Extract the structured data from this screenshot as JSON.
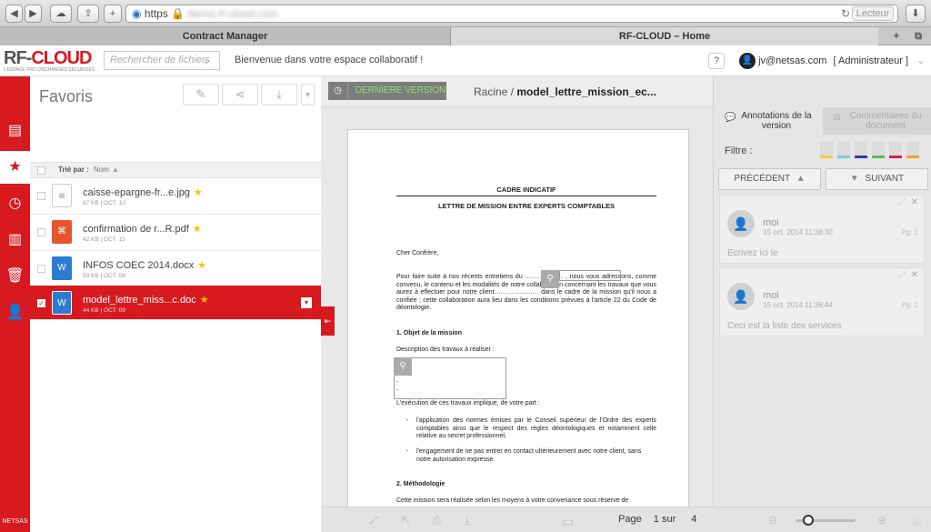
{
  "browser": {
    "back_icon": "left-arrow",
    "forward_icon": "right-arrow",
    "url_prefix": "https",
    "url_rest": "demo.rf-cloud.com",
    "reader_label": "Lecteur",
    "tabs": [
      {
        "label": "Contract Manager"
      },
      {
        "label": "RF-CLOUD – Home"
      }
    ]
  },
  "header": {
    "logo_main": "RF-",
    "logo_accent": "CLOUD",
    "logo_tagline": "L'ESPACE PRO D'ÉCHANGES SÉCURISÉS",
    "search_placeholder": "Rechercher de fichiers",
    "welcome": "Bienvenue dans votre espace collaboratif !",
    "help_label": "?",
    "user_email": "jv@netsas.com",
    "user_role": "[ Administrateur ]"
  },
  "rail": {
    "brand": "NETSAS"
  },
  "favorites": {
    "title": "Favoris",
    "sort_label": "Trié par :",
    "sort_field": "Nom",
    "files": [
      {
        "name": "caisse-epargne-fr...e.jpg",
        "meta": "67 KB  |  OCT. 10",
        "type": "image",
        "selected": false
      },
      {
        "name": "confirmation de r...R.pdf",
        "meta": "42 KB  |  OCT. 15",
        "type": "pdf",
        "selected": false
      },
      {
        "name": "INFOS COEC 2014.docx",
        "meta": "90 KB  |  OCT. 08",
        "type": "word",
        "selected": false
      },
      {
        "name": "model_lettre_miss...c.doc",
        "meta": "44 KB  |  OCT. 09",
        "type": "word",
        "selected": true
      }
    ]
  },
  "viewer": {
    "version_label": "DERNIERE VERSION",
    "breadcrumb_root": "Racine",
    "breadcrumb_sep": "/",
    "breadcrumb_file": "model_lettre_mission_ec...",
    "page_label": "Page",
    "page_current": "1",
    "page_of": "sur",
    "page_total": "4",
    "document": {
      "heading1": "CADRE INDICATIF",
      "heading2": "LETTRE DE MISSION ENTRE EXPERTS COMPTABLES",
      "salutation": "Cher Confrère,",
      "para1": "Pour faire suite à nos récents entretiens du ……………… , nous vous adressons, comme convenu, le contenu et les modalités de notre collaboration concernant les travaux que vous aurez à effectuer pour notre client………………… dans le cadre de la mission qu'il nous a confiée ; cette collaboration aura lieu dans les conditions prévues à l'article 22 du Code de déontologie.",
      "section1": "1.   Objet de la mission",
      "desc": "Description des travaux à réaliser :",
      "dash1": "-",
      "dash2": "-",
      "exec": "L'exécution de ces travaux implique, de votre part :",
      "bullet1": "l'application des normes émises par le Conseil supérieur de l'Ordre des experts comptables ainsi que le respect des règles déontologiques et notamment celle relative au secret professionnel,",
      "bullet2": "l'engagement de ne pas entrer en contact ultérieurement avec notre client, sans notre autorisation expresse.",
      "section2": "2.   Méthodologie",
      "method": "Cette mission sera réalisée selon les moyens à votre convenance sous réserve de"
    }
  },
  "annotations": {
    "tab_active": "Annotations de la version",
    "tab_inactive": "Commentaires du document",
    "filter_label": "Filtre :",
    "filter_colors": [
      "#f4d03f",
      "#7ec8e3",
      "#2c3e99",
      "#5cb85c",
      "#d81b60",
      "#f0a030"
    ],
    "prev_label": "PRÉCÉDENT",
    "next_label": "SUIVANT",
    "items": [
      {
        "author": "moi",
        "date": "15 oct. 2014 11:36:30",
        "page": "Pg. 1",
        "text": "Ecrivez ici le"
      },
      {
        "author": "moi",
        "date": "15 oct. 2014 11:36:44",
        "page": "Pg. 1",
        "text": "Ceci est la liste des services"
      }
    ]
  }
}
